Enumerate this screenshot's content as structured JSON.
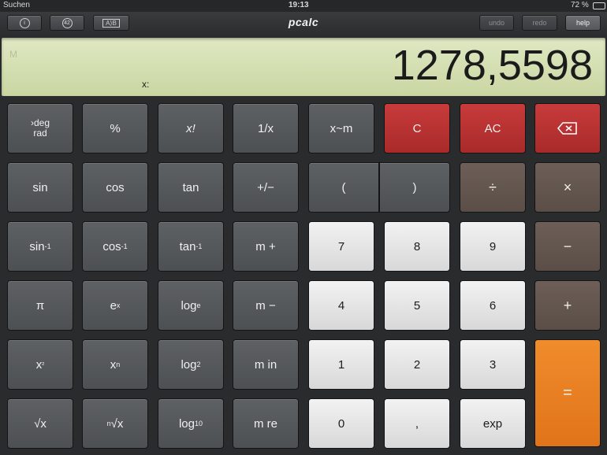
{
  "status": {
    "back": "Suchen",
    "time": "19:13",
    "battery": "72 %"
  },
  "toolbar": {
    "info": "i",
    "count": "42",
    "swap": "A⟩B",
    "title": "pcalc",
    "undo": "undo",
    "redo": "redo",
    "help": "help"
  },
  "display": {
    "memory": "M",
    "register": "x:",
    "value": "1278,5598"
  },
  "keys": {
    "deg_top": "›deg",
    "deg_bottom": "rad",
    "percent": "%",
    "factorial": "x!",
    "reciprocal": "1/x",
    "swap_memory": "x~m",
    "clear": "C",
    "all_clear": "AC",
    "sin": "sin",
    "cos": "cos",
    "tan": "tan",
    "sign": "+/−",
    "paren_open": "(",
    "paren_close": ")",
    "divide": "÷",
    "multiply": "×",
    "asin": "sin",
    "acos": "cos",
    "atan": "tan",
    "inv_exp": "-1",
    "mplus": "m +",
    "minus": "−",
    "pi": "π",
    "exp_e": "e",
    "exp_x": "x",
    "loge": "log",
    "loge_sub": "e",
    "mminus": "m −",
    "plus": "+",
    "sq": "x",
    "sq_exp": "²",
    "pow": "x",
    "pow_exp": "n",
    "log2": "log",
    "log2_sub": "2",
    "min": "m in",
    "sqrt": "√x",
    "nroot_n": "n",
    "nroot": "√x",
    "log10": "log",
    "log10_sub": "10",
    "mre": "m re",
    "d0": "0",
    "d1": "1",
    "d2": "2",
    "d3": "3",
    "d4": "4",
    "d5": "5",
    "d6": "6",
    "d7": "7",
    "d8": "8",
    "d9": "9",
    "comma": ",",
    "exp": "exp",
    "equals": "="
  }
}
